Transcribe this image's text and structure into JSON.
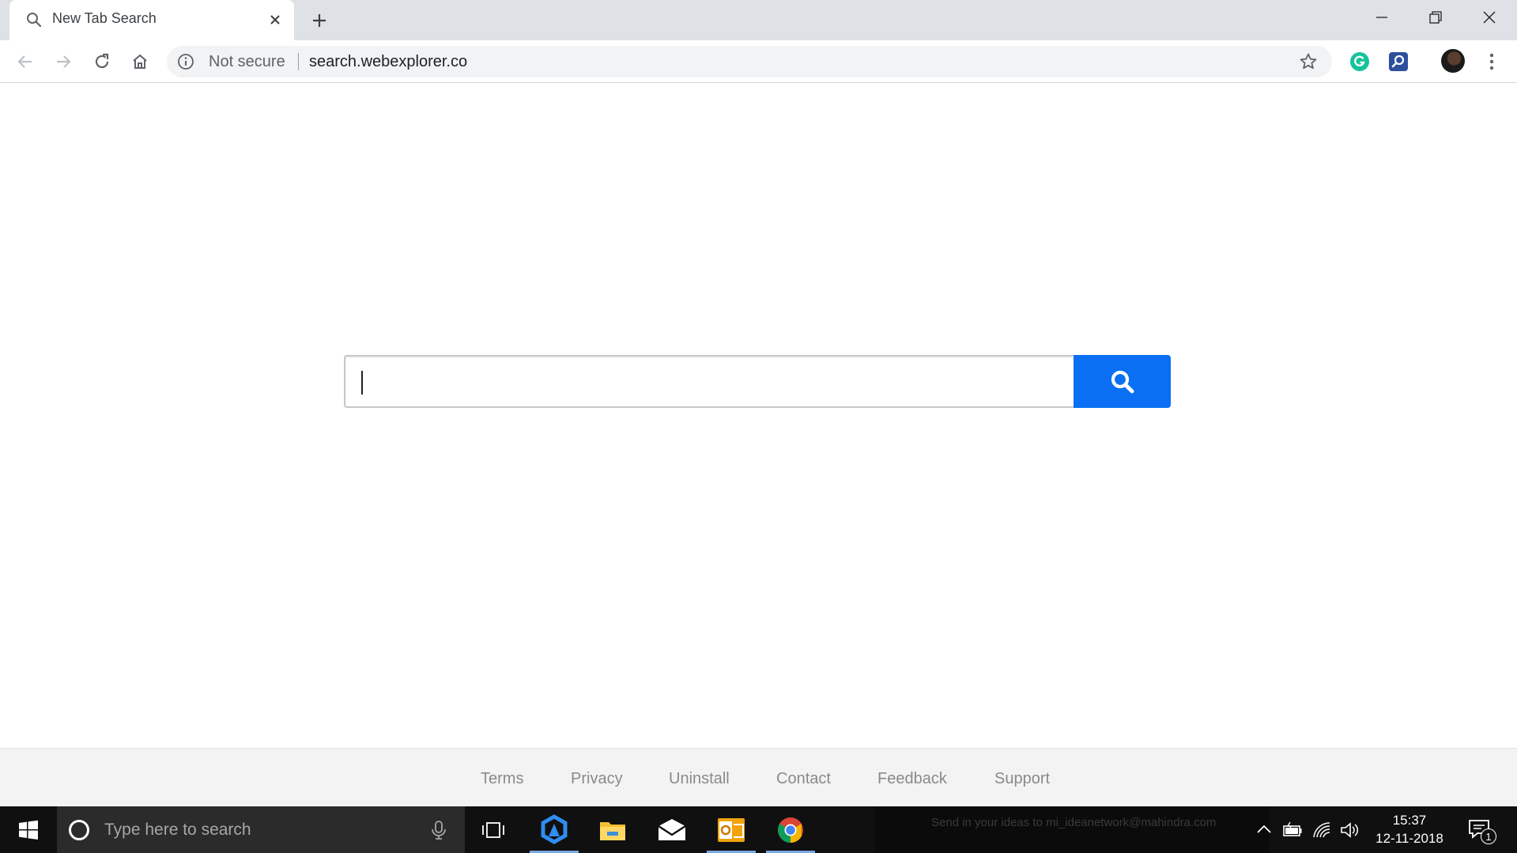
{
  "browser": {
    "tab": {
      "title": "New Tab Search",
      "icon": "search-icon"
    },
    "window_controls": [
      "minimize",
      "restore",
      "close"
    ],
    "omnibox": {
      "security_label": "Not secure",
      "url": "search.webexplorer.co"
    },
    "extensions": [
      "grammarly-icon",
      "search-extension-icon"
    ]
  },
  "page": {
    "search": {
      "value": "",
      "placeholder": ""
    },
    "footer_links": {
      "terms": "Terms",
      "privacy": "Privacy",
      "uninstall": "Uninstall",
      "contact": "Contact",
      "feedback": "Feedback",
      "support": "Support"
    }
  },
  "taskbar": {
    "search_placeholder": "Type here to search",
    "ticker": "Send in your ideas to mi_ideanetwork@mahindra.com",
    "clock": {
      "time": "15:37",
      "date": "12-11-2018"
    },
    "notifications": "1"
  },
  "colors": {
    "search_button": "#0a6ff3",
    "tab_strip": "#dee1e6",
    "taskbar": "#101010"
  }
}
